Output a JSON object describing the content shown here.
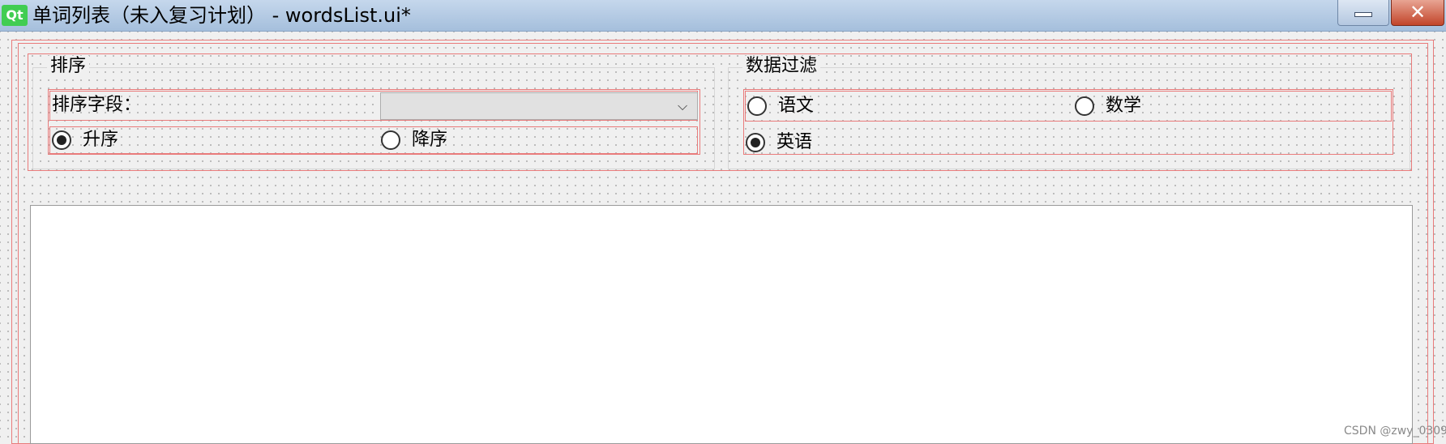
{
  "window": {
    "logo_text": "Qt",
    "title": "单词列表（未入复习计划） - wordsList.ui*",
    "close_glyph": "✕"
  },
  "sort_group": {
    "title": "排序",
    "field_label": "排序字段：",
    "field_value": "",
    "order_options": [
      {
        "label": "升序",
        "checked": true
      },
      {
        "label": "降序",
        "checked": false
      }
    ]
  },
  "filter_group": {
    "title": "数据过滤",
    "options": [
      {
        "label": "语文",
        "checked": false
      },
      {
        "label": "数学",
        "checked": false
      },
      {
        "label": "英语",
        "checked": true
      }
    ]
  },
  "watermark": "CSDN @zwy_0309",
  "icons": [
    "qt-logo-icon",
    "minimize-icon",
    "close-icon",
    "chevron-down-icon",
    "radio-icon"
  ],
  "colors": {
    "layout_border": "#e97b7b",
    "title_bar": "#a5bfdc",
    "close_button": "#c2452a",
    "qt_green": "#41cd52"
  }
}
